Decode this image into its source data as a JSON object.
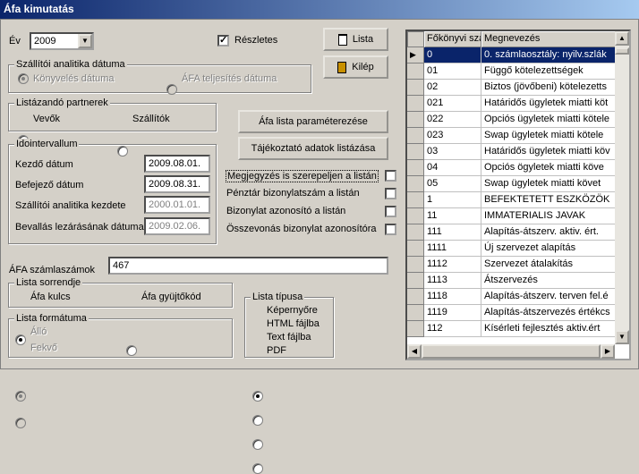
{
  "window": {
    "title": "Áfa kimutatás"
  },
  "year": {
    "label": "Év",
    "value": "2009"
  },
  "reszletes": {
    "label": "Részletes",
    "checked": true
  },
  "buttons": {
    "lista": "Lista",
    "kilep": "Kilép",
    "param": "Áfa lista paraméterezése",
    "tajekoztato": "Tájékoztató adatok listázása"
  },
  "szallitoi": {
    "caption": "Szállítói analitika dátuma",
    "opt1": "Könyvelés dátuma",
    "opt2": "ÁFA teljesítés dátuma"
  },
  "partnerek": {
    "caption": "Listázandó partnerek",
    "opt1": "Vevők",
    "opt2": "Szállítók"
  },
  "idointervallum": {
    "caption": "Idointervallum",
    "rows": [
      {
        "label": "Kezdő dátum",
        "value": "2009.08.01."
      },
      {
        "label": "Befejező dátum",
        "value": "2009.08.31."
      },
      {
        "label": "Szállítói analitika kezdete",
        "value": "2000.01.01."
      },
      {
        "label": "Bevallás lezárásának dátuma",
        "value": "2009.02.06."
      }
    ]
  },
  "checks": [
    "Megjegyzés is szerepeljen a listán",
    "Pénztár bizonylatszám a listán",
    "Bizonylat azonosító a listán",
    "Összevonás bizonylat azonosítóra"
  ],
  "afaszamlak": {
    "label": "ÁFA számlaszámok",
    "value": "467"
  },
  "sorrend": {
    "caption": "Lista sorrendje",
    "opt1": "Áfa kulcs",
    "opt2": "Áfa gyüjtőkód"
  },
  "formatum": {
    "caption": "Lista formátuma",
    "opt1": "Álló",
    "opt2": "Fekvő"
  },
  "tipus": {
    "caption": "Lista típusa",
    "opts": [
      "Képernyőre",
      "HTML fájlba",
      "Text fájlba",
      "PDF"
    ]
  },
  "grid": {
    "headers": [
      "Főkönyvi szám",
      "Megnevezés"
    ],
    "rows": [
      [
        "0",
        "0. számlaosztály: nyilv.szlák"
      ],
      [
        "01",
        "Függő kötelezettségek"
      ],
      [
        "02",
        "Biztos (jövőbeni) kötelezetts"
      ],
      [
        "021",
        "Határidős ügyletek miatti köt"
      ],
      [
        "022",
        "Opciós ügyletek miatti kötele"
      ],
      [
        "023",
        "Swap ügyletek miatti kötele"
      ],
      [
        "03",
        "Határidős ügyletek miatti köv"
      ],
      [
        "04",
        "Opciós ögyletek miatti köve"
      ],
      [
        "05",
        "Swap ügyletek miatti követ"
      ],
      [
        "1",
        "BEFEKTETETT ESZKÖZÖK"
      ],
      [
        "11",
        "IMMATERIALIS JAVAK"
      ],
      [
        "111",
        "Alapítás-átszerv. aktiv. ért."
      ],
      [
        "1111",
        "Új szervezet alapítás"
      ],
      [
        "1112",
        "Szervezet átalakítás"
      ],
      [
        "1113",
        "Átszervezés"
      ],
      [
        "1118",
        "Alapítás-átszerv. terven fel.é"
      ],
      [
        "1119",
        "Alapítás-átszervezés értékcs"
      ],
      [
        "112",
        "Kísérleti fejlesztés aktiv.ért"
      ]
    ],
    "current_marker": "▶"
  }
}
